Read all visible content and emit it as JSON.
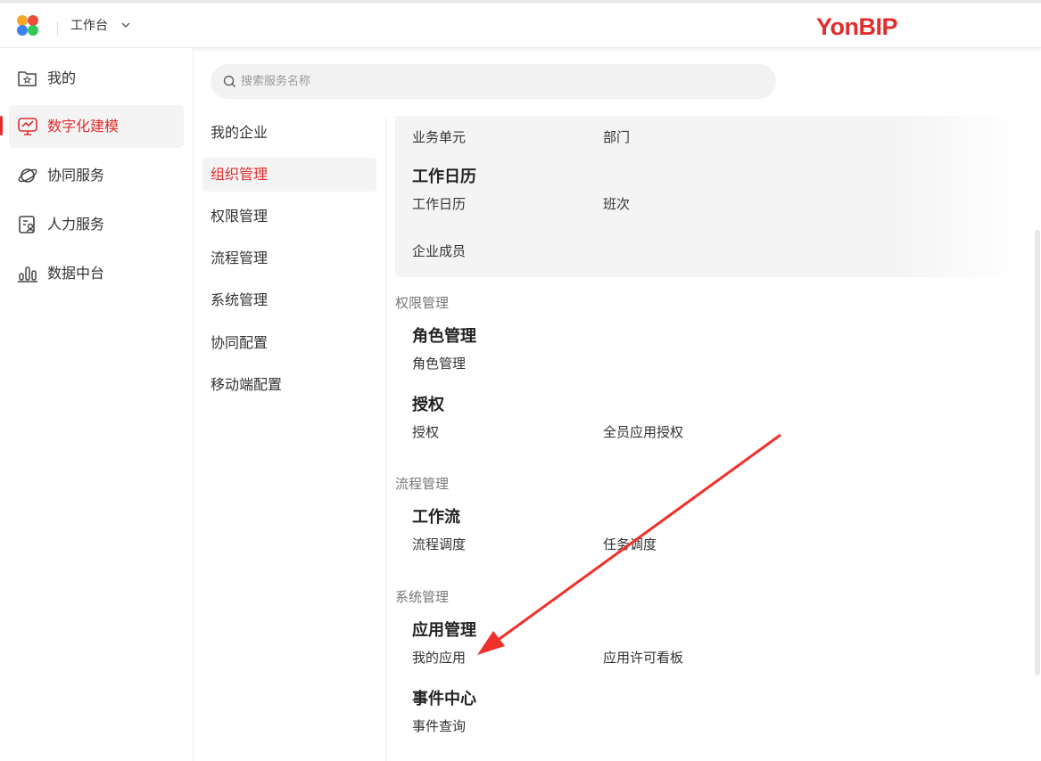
{
  "header": {
    "workspace_label": "工作台",
    "brand": "YonBIP",
    "brand_color": "#e12d2d"
  },
  "sidebar": {
    "items": [
      {
        "label": "我的",
        "icon": "folder-star-icon"
      },
      {
        "label": "数字化建模",
        "icon": "monitor-chart-icon",
        "active": true
      },
      {
        "label": "协同服务",
        "icon": "planet-icon"
      },
      {
        "label": "人力服务",
        "icon": "id-card-icon"
      },
      {
        "label": "数据中台",
        "icon": "bar-chart-icon"
      }
    ]
  },
  "search": {
    "placeholder": "搜索服务名称",
    "value": ""
  },
  "categories": {
    "items": [
      {
        "label": "我的企业"
      },
      {
        "label": "组织管理",
        "active": true
      },
      {
        "label": "权限管理"
      },
      {
        "label": "流程管理"
      },
      {
        "label": "系统管理"
      },
      {
        "label": "协同配置"
      },
      {
        "label": "移动端配置"
      }
    ]
  },
  "content": {
    "org": {
      "links": [
        "业务单元",
        "部门"
      ],
      "calendar_title": "工作日历",
      "calendar_links": [
        "工作日历",
        "班次"
      ],
      "member_link": "企业成员"
    },
    "perm": {
      "section": "权限管理",
      "role_title": "角色管理",
      "role_links": [
        "角色管理"
      ],
      "auth_title": "授权",
      "auth_links": [
        "授权",
        "全员应用授权"
      ]
    },
    "flow": {
      "section": "流程管理",
      "wf_title": "工作流",
      "wf_links": [
        "流程调度",
        "任务调度"
      ]
    },
    "sys": {
      "section": "系统管理",
      "app_title": "应用管理",
      "app_links": [
        "我的应用",
        "应用许可看板"
      ],
      "event_title": "事件中心",
      "event_links": [
        "事件查询"
      ]
    }
  },
  "annotation": {
    "arrow_color": "#f0302a"
  }
}
